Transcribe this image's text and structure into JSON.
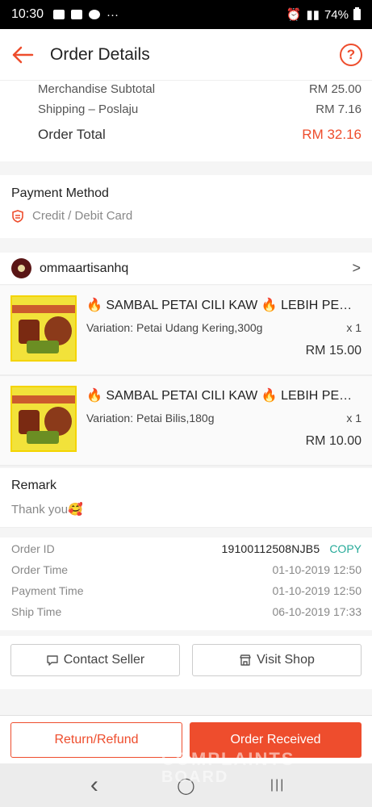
{
  "status_bar": {
    "time": "10:30",
    "more": "···",
    "battery": "74%"
  },
  "header": {
    "title": "Order Details",
    "help": "?"
  },
  "summary": {
    "rows": [
      {
        "label": "Merchandise Subtotal",
        "value": "RM 25.00"
      },
      {
        "label": "Shipping – Poslaju",
        "value": "RM 7.16"
      },
      {
        "label": "Order Total",
        "value": "RM 32.16"
      }
    ]
  },
  "payment": {
    "heading": "Payment Method",
    "method": "Credit / Debit Card"
  },
  "shop": {
    "name": "ommaartisanhq",
    "chevron": ">"
  },
  "items": [
    {
      "name": "🔥 SAMBAL PETAI CILI KAW 🔥 LEBIH PEDAS",
      "variation": "Variation: Petai Udang Kering,300g",
      "qty": "x 1",
      "price": "RM 15.00"
    },
    {
      "name": "🔥 SAMBAL PETAI CILI KAW 🔥 LEBIH PEDAS",
      "variation": "Variation: Petai Bilis,180g",
      "qty": "x 1",
      "price": "RM 10.00"
    }
  ],
  "remark": {
    "heading": "Remark",
    "text": "Thank you🥰"
  },
  "order_info": {
    "rows": [
      {
        "label": "Order ID",
        "value": "19100112508NJB5",
        "action": "COPY"
      },
      {
        "label": "Order Time",
        "value": "01-10-2019 12:50"
      },
      {
        "label": "Payment Time",
        "value": "01-10-2019 12:50"
      },
      {
        "label": "Ship Time",
        "value": "06-10-2019 17:33"
      }
    ]
  },
  "actions": {
    "contact": "Contact Seller",
    "visit": "Visit Shop"
  },
  "bottom": {
    "refund": "Return/Refund",
    "received": "Order Received"
  },
  "navbar": {
    "back": "‹",
    "home": "◯",
    "recent": "|||"
  },
  "watermark": {
    "line1": "COMPLAINTS",
    "line2": "BOARD"
  },
  "colors": {
    "accent": "#ee4d2d",
    "copy": "#26aa99"
  }
}
